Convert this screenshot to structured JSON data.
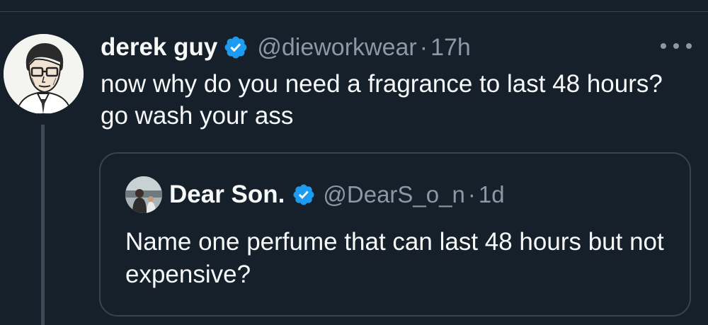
{
  "tweet": {
    "author_name": "derek guy",
    "handle": "@dieworkwear",
    "separator": "·",
    "time": "17h",
    "text": "now why do you need a fragrance to last 48 hours? go wash your ass",
    "avatar_icon": "illustrated-man-portrait",
    "verified_icon": "verified-badge-icon",
    "more_icon": "more-options-icon"
  },
  "quote": {
    "author_name": "Dear Son.",
    "handle": "@DearS_o_n",
    "separator": "·",
    "time": "1d",
    "text": "Name one perfume that can last 48 hours but not expensive?",
    "avatar_icon": "photo-avatar",
    "verified_icon": "verified-badge-icon"
  },
  "colors": {
    "background": "#15202b",
    "text_primary": "#f7f9f9",
    "text_secondary": "#8b98a5",
    "border": "#38444d",
    "verified_blue": "#1d9bf0"
  }
}
